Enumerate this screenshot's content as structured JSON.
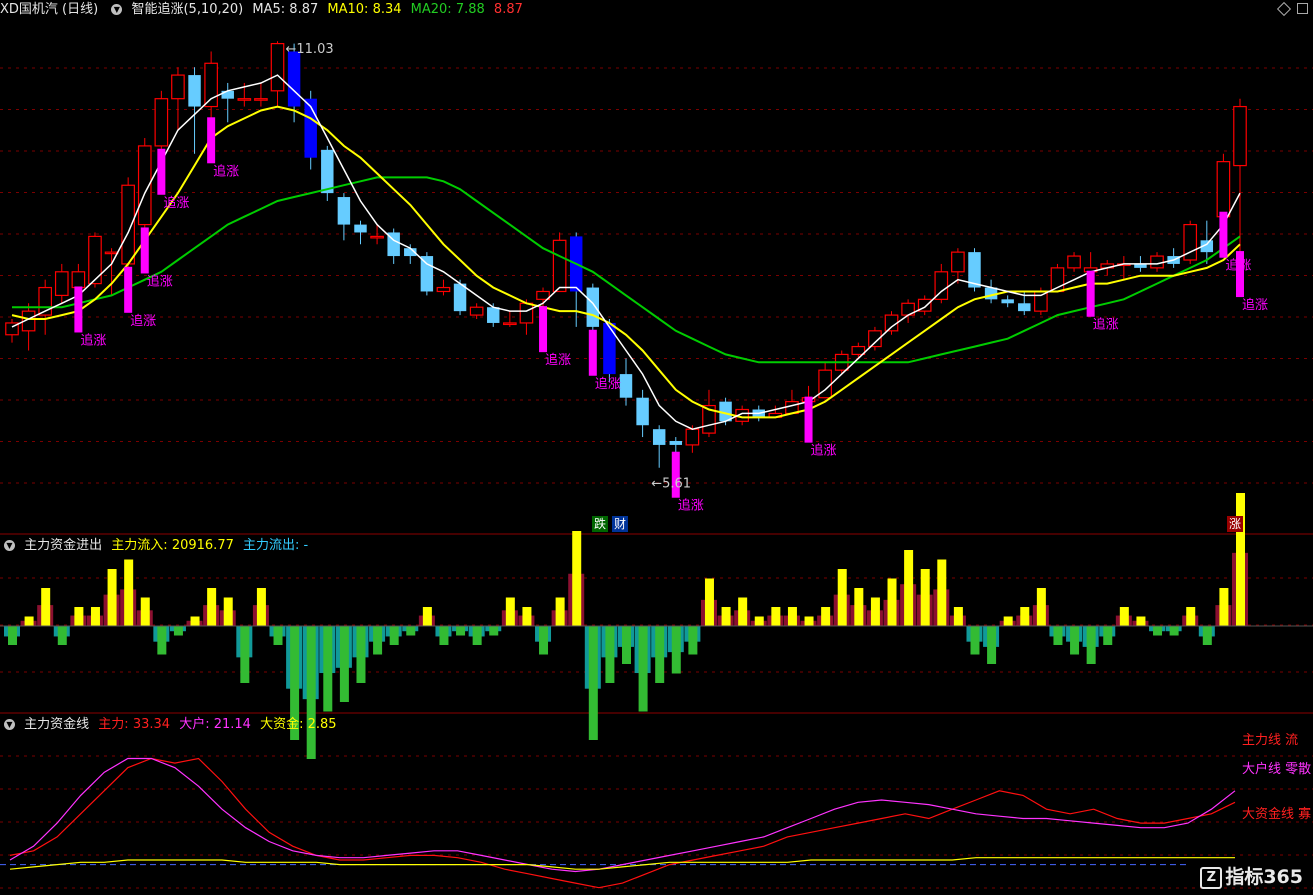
{
  "header_main": {
    "symbol": "XD国机汽 (日线)",
    "indicator": "智能追涨(5,10,20)",
    "ma5_label": "MA5:",
    "ma5": "8.87",
    "ma10_label": "MA10:",
    "ma10": "8.34",
    "ma20_label": "MA20:",
    "ma20": "7.88",
    "extra": "8.87"
  },
  "header_mid": {
    "title": "主力资金进出",
    "inflow_label": "主力流入:",
    "inflow": "20916.77",
    "outflow_label": "主力流出:",
    "outflow": "-"
  },
  "header_bot": {
    "title": "主力资金线",
    "main_label": "主力:",
    "main": "33.34",
    "big_label": "大户:",
    "big": "21.14",
    "fund_label": "大资金:",
    "fund": "2.85"
  },
  "annotations": {
    "high": "11.03",
    "low": "5.61",
    "chase": "追涨",
    "fall_tag": "跌",
    "fin_tag": "财",
    "rise_tag": "涨",
    "right_labels": [
      "主力线 流",
      "大户线 零散",
      "大资金线 寡"
    ]
  },
  "logo": {
    "icon": "Z",
    "text": "指标365"
  },
  "colors": {
    "up": "#ff0000",
    "down_fill": "#66ccff",
    "down_strong": "#0000ff",
    "ma5": "#ffffff",
    "ma10": "#ffff00",
    "ma20": "#00cc00",
    "chase": "#ff00ff",
    "flow_pos": "#ffff00",
    "flow_pos_dim": "#8b1030",
    "flow_neg": "#33bb33",
    "flow_neg_dim": "#119999"
  },
  "chart_data": [
    {
      "type": "candlestick",
      "title": "智能追涨(5,10,20)",
      "ylim": [
        5.2,
        11.3
      ],
      "candles": [
        [
          7.3,
          7.45,
          7.2,
          7.5
        ],
        [
          7.35,
          7.6,
          7.1,
          7.7
        ],
        [
          7.55,
          7.9,
          7.3,
          8.0
        ],
        [
          7.8,
          8.1,
          7.7,
          8.2
        ],
        [
          7.9,
          8.1,
          7.85,
          8.2
        ],
        [
          7.95,
          8.55,
          7.9,
          8.6
        ],
        [
          8.35,
          8.35,
          7.8,
          8.4
        ],
        [
          8.2,
          9.2,
          8.1,
          9.3
        ],
        [
          8.7,
          9.7,
          8.6,
          9.8
        ],
        [
          9.7,
          10.3,
          9.6,
          10.4
        ],
        [
          10.3,
          10.6,
          9.9,
          10.7
        ],
        [
          10.6,
          10.2,
          9.6,
          10.7
        ],
        [
          10.2,
          10.75,
          10.0,
          10.9
        ],
        [
          10.4,
          10.3,
          10.0,
          10.5
        ],
        [
          10.3,
          10.3,
          10.2,
          10.5
        ],
        [
          10.3,
          10.3,
          10.2,
          10.5
        ],
        [
          10.4,
          11.0,
          10.2,
          11.03
        ],
        [
          10.9,
          10.2,
          10.0,
          11.0
        ],
        [
          10.3,
          9.55,
          9.4,
          10.4
        ],
        [
          9.65,
          9.1,
          9.0,
          9.7
        ],
        [
          9.05,
          8.7,
          8.5,
          9.1
        ],
        [
          8.7,
          8.6,
          8.45,
          8.75
        ],
        [
          8.55,
          8.55,
          8.45,
          8.7
        ],
        [
          8.6,
          8.3,
          8.2,
          8.65
        ],
        [
          8.4,
          8.3,
          8.2,
          8.45
        ],
        [
          8.3,
          7.85,
          7.8,
          8.35
        ],
        [
          7.85,
          7.9,
          7.8,
          8.0
        ],
        [
          7.95,
          7.6,
          7.55,
          8.0
        ],
        [
          7.55,
          7.65,
          7.5,
          7.7
        ],
        [
          7.65,
          7.45,
          7.4,
          7.7
        ],
        [
          7.45,
          7.45,
          7.4,
          7.6
        ],
        [
          7.45,
          7.7,
          7.3,
          7.75
        ],
        [
          7.75,
          7.85,
          7.6,
          7.9
        ],
        [
          7.85,
          8.5,
          7.85,
          8.6
        ],
        [
          8.55,
          7.85,
          7.4,
          8.6
        ],
        [
          7.9,
          7.4,
          7.3,
          7.95
        ],
        [
          7.45,
          6.8,
          6.7,
          7.5
        ],
        [
          6.8,
          6.5,
          6.4,
          7.0
        ],
        [
          6.5,
          6.15,
          6.0,
          6.6
        ],
        [
          6.1,
          5.9,
          5.61,
          6.15
        ],
        [
          5.95,
          5.9,
          5.75,
          6.0
        ],
        [
          5.9,
          6.1,
          5.8,
          6.15
        ],
        [
          6.05,
          6.4,
          6.0,
          6.6
        ],
        [
          6.45,
          6.2,
          6.15,
          6.5
        ],
        [
          6.2,
          6.35,
          6.15,
          6.4
        ],
        [
          6.35,
          6.25,
          6.2,
          6.4
        ],
        [
          6.25,
          6.3,
          6.25,
          6.4
        ],
        [
          6.3,
          6.45,
          6.3,
          6.6
        ],
        [
          6.45,
          6.5,
          6.45,
          6.65
        ],
        [
          6.5,
          6.85,
          6.5,
          6.95
        ],
        [
          6.85,
          7.05,
          6.8,
          7.1
        ],
        [
          7.05,
          7.15,
          7.0,
          7.2
        ],
        [
          7.15,
          7.35,
          7.1,
          7.4
        ],
        [
          7.35,
          7.55,
          7.3,
          7.6
        ],
        [
          7.55,
          7.7,
          7.45,
          7.75
        ],
        [
          7.6,
          7.75,
          7.55,
          7.8
        ],
        [
          7.75,
          8.1,
          7.7,
          8.2
        ],
        [
          8.1,
          8.35,
          7.95,
          8.4
        ],
        [
          8.35,
          7.9,
          7.85,
          8.4
        ],
        [
          7.9,
          7.75,
          7.7,
          8.0
        ],
        [
          7.75,
          7.7,
          7.65,
          7.8
        ],
        [
          7.7,
          7.6,
          7.55,
          7.85
        ],
        [
          7.6,
          7.85,
          7.55,
          7.9
        ],
        [
          7.85,
          8.15,
          7.85,
          8.2
        ],
        [
          8.15,
          8.3,
          8.1,
          8.35
        ],
        [
          8.1,
          8.15,
          8.05,
          8.35
        ],
        [
          8.15,
          8.2,
          8.05,
          8.25
        ],
        [
          8.2,
          8.2,
          8.0,
          8.3
        ],
        [
          8.2,
          8.15,
          8.1,
          8.3
        ],
        [
          8.15,
          8.3,
          8.1,
          8.35
        ],
        [
          8.3,
          8.2,
          8.15,
          8.4
        ],
        [
          8.25,
          8.7,
          8.2,
          8.75
        ],
        [
          8.5,
          8.35,
          8.2,
          8.75
        ],
        [
          8.8,
          9.5,
          8.8,
          9.6
        ],
        [
          9.45,
          10.2,
          8.3,
          10.3
        ]
      ],
      "ma5": [
        7.4,
        7.5,
        7.6,
        7.7,
        7.8,
        8.0,
        8.2,
        8.6,
        9.1,
        9.5,
        9.9,
        10.1,
        10.3,
        10.4,
        10.45,
        10.5,
        10.6,
        10.4,
        10.2,
        9.8,
        9.4,
        9.0,
        8.7,
        8.5,
        8.4,
        8.2,
        8.1,
        7.95,
        7.8,
        7.65,
        7.6,
        7.6,
        7.7,
        7.9,
        7.9,
        7.7,
        7.4,
        7.1,
        6.8,
        6.4,
        6.2,
        6.1,
        6.15,
        6.2,
        6.3,
        6.3,
        6.35,
        6.4,
        6.45,
        6.6,
        6.8,
        7.0,
        7.2,
        7.4,
        7.55,
        7.65,
        7.85,
        8.0,
        7.95,
        7.9,
        7.85,
        7.8,
        7.8,
        7.9,
        8.0,
        8.1,
        8.15,
        8.2,
        8.2,
        8.2,
        8.25,
        8.35,
        8.45,
        8.7,
        9.1
      ],
      "ma10": [
        7.55,
        7.5,
        7.5,
        7.55,
        7.6,
        7.75,
        7.95,
        8.2,
        8.5,
        8.8,
        9.1,
        9.45,
        9.8,
        9.95,
        10.05,
        10.15,
        10.2,
        10.15,
        10.05,
        9.9,
        9.7,
        9.55,
        9.35,
        9.15,
        8.95,
        8.7,
        8.45,
        8.25,
        8.05,
        7.9,
        7.8,
        7.7,
        7.65,
        7.6,
        7.6,
        7.55,
        7.45,
        7.3,
        7.1,
        6.85,
        6.6,
        6.45,
        6.35,
        6.3,
        6.25,
        6.25,
        6.25,
        6.3,
        6.35,
        6.45,
        6.6,
        6.75,
        6.9,
        7.05,
        7.2,
        7.35,
        7.5,
        7.65,
        7.75,
        7.8,
        7.85,
        7.85,
        7.85,
        7.85,
        7.9,
        7.95,
        7.95,
        8.0,
        8.05,
        8.05,
        8.05,
        8.1,
        8.15,
        8.25,
        8.45
      ],
      "ma20": [
        7.65,
        7.65,
        7.65,
        7.65,
        7.7,
        7.75,
        7.8,
        7.9,
        8.0,
        8.1,
        8.25,
        8.4,
        8.55,
        8.7,
        8.8,
        8.9,
        9.0,
        9.05,
        9.1,
        9.15,
        9.2,
        9.25,
        9.3,
        9.3,
        9.3,
        9.3,
        9.25,
        9.15,
        9.0,
        8.85,
        8.7,
        8.55,
        8.4,
        8.3,
        8.2,
        8.1,
        7.95,
        7.8,
        7.65,
        7.5,
        7.35,
        7.25,
        7.15,
        7.05,
        7.0,
        6.95,
        6.95,
        6.95,
        6.95,
        6.95,
        6.95,
        6.95,
        6.95,
        6.95,
        6.95,
        7.0,
        7.05,
        7.1,
        7.15,
        7.2,
        7.25,
        7.35,
        7.45,
        7.55,
        7.6,
        7.65,
        7.7,
        7.75,
        7.85,
        7.95,
        8.05,
        8.15,
        8.25,
        8.4,
        8.55
      ],
      "chase_days": [
        4,
        7,
        8,
        9,
        12,
        32,
        35,
        40,
        48,
        65,
        73,
        74
      ]
    },
    {
      "type": "bar",
      "title": "主力资金进出",
      "values": [
        -2,
        1,
        4,
        -2,
        2,
        2,
        6,
        7,
        3,
        -3,
        -1,
        1,
        4,
        3,
        -6,
        4,
        -2,
        -12,
        -14,
        -9,
        -8,
        -6,
        -3,
        -2,
        -1,
        2,
        -2,
        -1,
        -2,
        -1,
        3,
        2,
        -3,
        3,
        10,
        -12,
        -6,
        -4,
        -9,
        -6,
        -5,
        -3,
        5,
        2,
        3,
        1,
        2,
        2,
        1,
        2,
        6,
        4,
        3,
        5,
        8,
        6,
        7,
        2,
        -3,
        -4,
        1,
        2,
        4,
        -2,
        -3,
        -4,
        -2,
        2,
        1,
        -1,
        -1,
        2,
        -2,
        4,
        14
      ],
      "ylim": [
        -16,
        16
      ]
    },
    {
      "type": "line",
      "title": "主力资金线",
      "ylim": [
        -5,
        60
      ],
      "series": [
        {
          "name": "主力",
          "values": [
            10,
            12,
            18,
            28,
            38,
            48,
            52,
            50,
            52,
            42,
            30,
            20,
            14,
            10,
            8,
            8,
            9,
            10,
            10,
            9,
            7,
            4,
            2,
            0,
            -2,
            -4,
            -2,
            2,
            6,
            8,
            10,
            12,
            14,
            18,
            20,
            22,
            24,
            26,
            28,
            26,
            30,
            34,
            38,
            36,
            30,
            28,
            30,
            26,
            24,
            24,
            26,
            28,
            33
          ]
        },
        {
          "name": "大户",
          "values": [
            8,
            14,
            24,
            36,
            46,
            52,
            52,
            48,
            40,
            30,
            22,
            16,
            12,
            10,
            9,
            9,
            10,
            11,
            12,
            12,
            10,
            8,
            6,
            4,
            3,
            4,
            6,
            8,
            10,
            12,
            14,
            16,
            18,
            22,
            26,
            30,
            33,
            34,
            33,
            32,
            30,
            28,
            27,
            26,
            26,
            25,
            24,
            23,
            22,
            22,
            24,
            30,
            38
          ]
        },
        {
          "name": "大资金",
          "values": [
            4,
            5,
            6,
            7,
            7,
            8,
            8,
            8,
            8,
            8,
            7,
            7,
            7,
            7,
            6,
            6,
            6,
            6,
            6,
            6,
            6,
            6,
            6,
            5,
            4,
            4,
            5,
            6,
            7,
            7,
            7,
            7,
            7,
            7,
            8,
            8,
            8,
            8,
            8,
            8,
            8,
            9,
            9,
            9,
            9,
            9,
            9,
            9,
            9,
            9,
            9,
            9,
            9
          ]
        }
      ]
    }
  ]
}
